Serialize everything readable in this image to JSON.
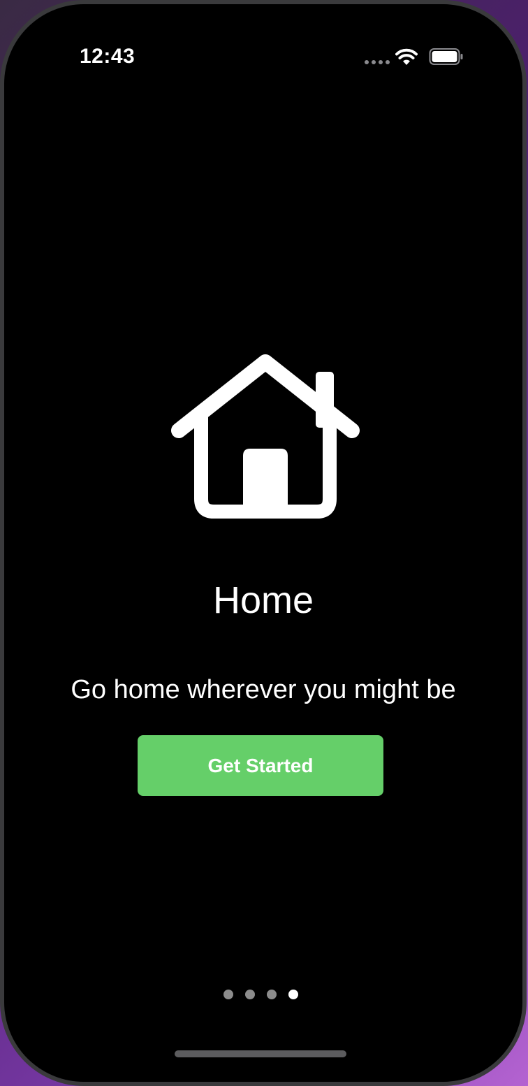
{
  "status_bar": {
    "time": "12:43",
    "wifi_icon": "wifi-icon",
    "battery_icon": "battery-icon"
  },
  "onboarding": {
    "icon": "house-icon",
    "title": "Home",
    "subtitle": "Go home wherever you might be",
    "cta_label": "Get Started",
    "cta_color": "#65cf69"
  },
  "pager": {
    "total_pages": 4,
    "current_page": 4
  }
}
